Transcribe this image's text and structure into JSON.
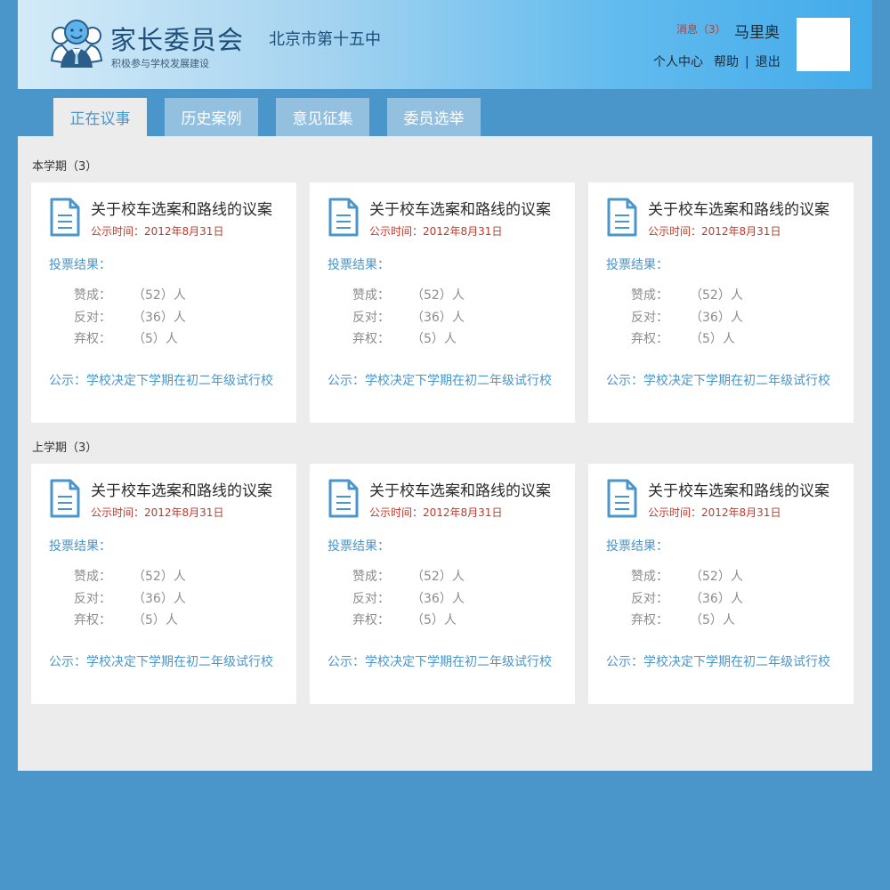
{
  "header": {
    "title": "家长委员会",
    "school": "北京市第十五中",
    "slogan": "积极参与学校发展建设",
    "messages": "消息（3）",
    "user_name": "马里奥",
    "links": [
      "个人中心",
      "帮助",
      "|",
      "退出"
    ]
  },
  "tabs": [
    {
      "label": "正在议事",
      "active": true
    },
    {
      "label": "历史案例",
      "active": false
    },
    {
      "label": "意见征集",
      "active": false
    },
    {
      "label": "委员选举",
      "active": false
    }
  ],
  "sections": [
    {
      "title": "本学期（3）",
      "cards": [
        {
          "title": "关于校车选案和路线的议案",
          "date": "公示时间：2012年8月31日",
          "vote_label": "投票结果：",
          "votes": [
            {
              "label": "赞成：",
              "value": "（52）人"
            },
            {
              "label": "反对：",
              "value": "（36）人"
            },
            {
              "label": "弃权：",
              "value": "（5）人"
            }
          ],
          "notice": "公示：学校决定下学期在初二年级试行校"
        },
        {
          "title": "关于校车选案和路线的议案",
          "date": "公示时间：2012年8月31日",
          "vote_label": "投票结果：",
          "votes": [
            {
              "label": "赞成：",
              "value": "（52）人"
            },
            {
              "label": "反对：",
              "value": "（36）人"
            },
            {
              "label": "弃权：",
              "value": "（5）人"
            }
          ],
          "notice": "公示：学校决定下学期在初二年级试行校"
        },
        {
          "title": "关于校车选案和路线的议案",
          "date": "公示时间：2012年8月31日",
          "vote_label": "投票结果：",
          "votes": [
            {
              "label": "赞成：",
              "value": "（52）人"
            },
            {
              "label": "反对：",
              "value": "（36）人"
            },
            {
              "label": "弃权：",
              "value": "（5）人"
            }
          ],
          "notice": "公示：学校决定下学期在初二年级试行校"
        }
      ]
    },
    {
      "title": "上学期（3）",
      "cards": [
        {
          "title": "关于校车选案和路线的议案",
          "date": "公示时间：2012年8月31日",
          "vote_label": "投票结果：",
          "votes": [
            {
              "label": "赞成：",
              "value": "（52）人"
            },
            {
              "label": "反对：",
              "value": "（36）人"
            },
            {
              "label": "弃权：",
              "value": "（5）人"
            }
          ],
          "notice": "公示：学校决定下学期在初二年级试行校"
        },
        {
          "title": "关于校车选案和路线的议案",
          "date": "公示时间：2012年8月31日",
          "vote_label": "投票结果：",
          "votes": [
            {
              "label": "赞成：",
              "value": "（52）人"
            },
            {
              "label": "反对：",
              "value": "（36）人"
            },
            {
              "label": "弃权：",
              "value": "（5）人"
            }
          ],
          "notice": "公示：学校决定下学期在初二年级试行校"
        },
        {
          "title": "关于校车选案和路线的议案",
          "date": "公示时间：2012年8月31日",
          "vote_label": "投票结果：",
          "votes": [
            {
              "label": "赞成：",
              "value": "（52）人"
            },
            {
              "label": "反对：",
              "value": "（36）人"
            },
            {
              "label": "弃权：",
              "value": "（5）人"
            }
          ],
          "notice": "公示：学校决定下学期在初二年级试行校"
        }
      ]
    }
  ],
  "colors": {
    "background": "#4a95c9",
    "accent": "#4a95c9",
    "date_red": "#c0392b",
    "panel": "#ececec"
  },
  "icons": [
    "people-logo-icon",
    "document-icon"
  ]
}
